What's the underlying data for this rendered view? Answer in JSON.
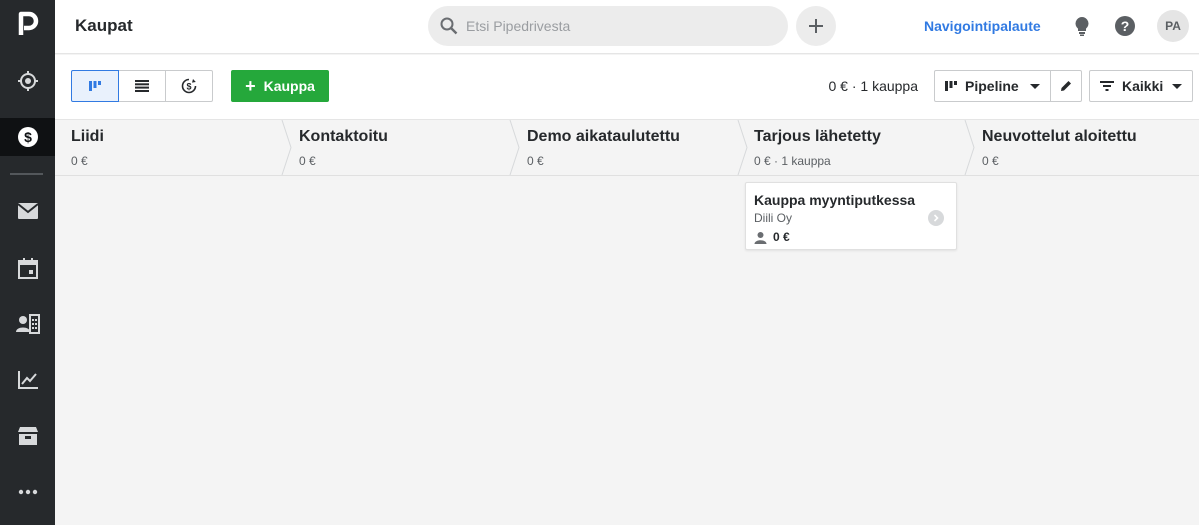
{
  "header": {
    "title": "Kaupat",
    "search_placeholder": "Etsi Pipedrivesta",
    "feedback_link": "Navigointipalaute",
    "avatar_initials": "PA"
  },
  "toolbar": {
    "add_deal_label": "Kauppa",
    "summary": "0 € · 1 kauppa",
    "pipeline_label": "Pipeline",
    "filter_label": "Kaikki"
  },
  "stages": [
    {
      "name": "Liidi",
      "meta": "0 €"
    },
    {
      "name": "Kontaktoitu",
      "meta": "0 €"
    },
    {
      "name": "Demo aikataulutettu",
      "meta": "0 €"
    },
    {
      "name": "Tarjous lähetetty",
      "meta": "0 € · 1 kauppa"
    },
    {
      "name": "Neuvottelut aloitettu",
      "meta": "0 €"
    }
  ],
  "deal": {
    "title": "Kauppa myyntiputkessa",
    "organization": "Diili Oy",
    "value": "0 €"
  },
  "colors": {
    "sidebar": "#26292c",
    "accent_blue": "#317ae2",
    "accent_green": "#25a83b"
  },
  "icons": {
    "sidebar": [
      "pipedrive-logo-icon",
      "target-icon",
      "deals-icon",
      "mail-icon",
      "calendar-icon",
      "contacts-icon",
      "insights-icon",
      "products-icon",
      "more-icon"
    ],
    "top": [
      "search-icon",
      "plus-icon",
      "lightbulb-icon",
      "help-icon"
    ]
  }
}
